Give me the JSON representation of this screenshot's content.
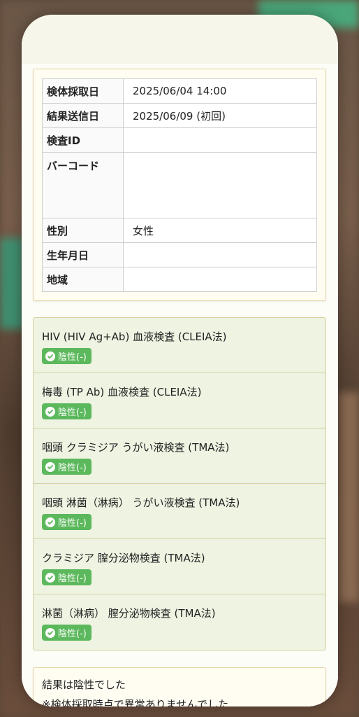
{
  "info_table": {
    "rows": [
      {
        "label": "検体採取日",
        "value": "2025/06/04 14:00"
      },
      {
        "label": "結果送信日",
        "value": "2025/06/09 (初回)"
      },
      {
        "label": "検査ID",
        "value": ""
      },
      {
        "label": "バーコード",
        "value": ""
      },
      {
        "label": "性別",
        "value": "女性"
      },
      {
        "label": "生年月日",
        "value": ""
      },
      {
        "label": "地域",
        "value": ""
      }
    ]
  },
  "results": [
    {
      "title": "HIV (HIV Ag+Ab) 血液検査 (CLEIA法)",
      "badge": "陰性(-)"
    },
    {
      "title": "梅毒 (TP Ab) 血液検査 (CLEIA法)",
      "badge": "陰性(-)"
    },
    {
      "title": "咽頭 クラミジア うがい液検査 (TMA法)",
      "badge": "陰性(-)"
    },
    {
      "title": "咽頭 淋菌（淋病） うがい液検査 (TMA法)",
      "badge": "陰性(-)"
    },
    {
      "title": "クラミジア 膣分泌物検査 (TMA法)",
      "badge": "陰性(-)"
    },
    {
      "title": "淋菌（淋病） 膣分泌物検査 (TMA法)",
      "badge": "陰性(-)"
    }
  ],
  "summary": {
    "line1": "結果は陰性でした",
    "line2": "※検体採取時点で異常ありませんでした"
  },
  "colors": {
    "badge_green": "#5cb85c",
    "results_bg": "#eef3e2",
    "card_border": "#e3d5a4"
  }
}
